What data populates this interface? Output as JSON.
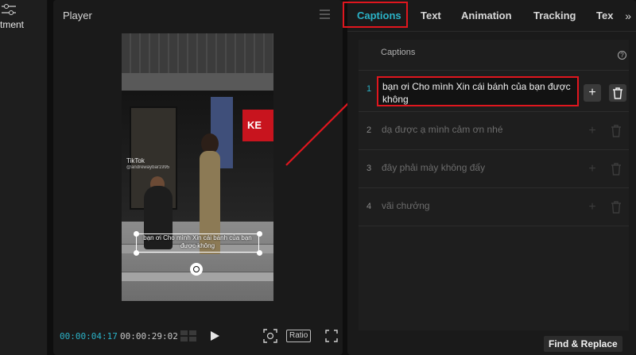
{
  "left_panel": {
    "label": "tment",
    "icon": "adjustment-icon"
  },
  "player": {
    "title": "Player",
    "time_current": "00:00:04:17",
    "time_total": "00:00:29:02",
    "ratio_label": "Ratio",
    "video": {
      "store_sign": "KE",
      "watermark": "TikTok",
      "watermark_handle": "@andrewaybar1995",
      "caption_overlay": "bạn ơi Cho mình Xin cái bánh của bạn được không"
    }
  },
  "tabs": [
    {
      "label": "Captions",
      "active": true
    },
    {
      "label": "Text",
      "active": false
    },
    {
      "label": "Animation",
      "active": false
    },
    {
      "label": "Tracking",
      "active": false
    },
    {
      "label": "Tex",
      "active": false
    }
  ],
  "tabs_more": "»",
  "captions": {
    "header": "Captions",
    "rows": [
      {
        "index": "1",
        "text": "bạn ơi Cho mình Xin cái bánh của bạn được không"
      },
      {
        "index": "2",
        "text": "dạ được ạ mình cảm ơn nhé"
      },
      {
        "index": "3",
        "text": "đây phải mày không đấy"
      },
      {
        "index": "4",
        "text": "vãi chưởng"
      }
    ]
  },
  "find_replace_label": "Find & Replace",
  "colors": {
    "accent": "#2bb2c7",
    "highlight": "#e0161e",
    "background": "#1a1a1a"
  }
}
